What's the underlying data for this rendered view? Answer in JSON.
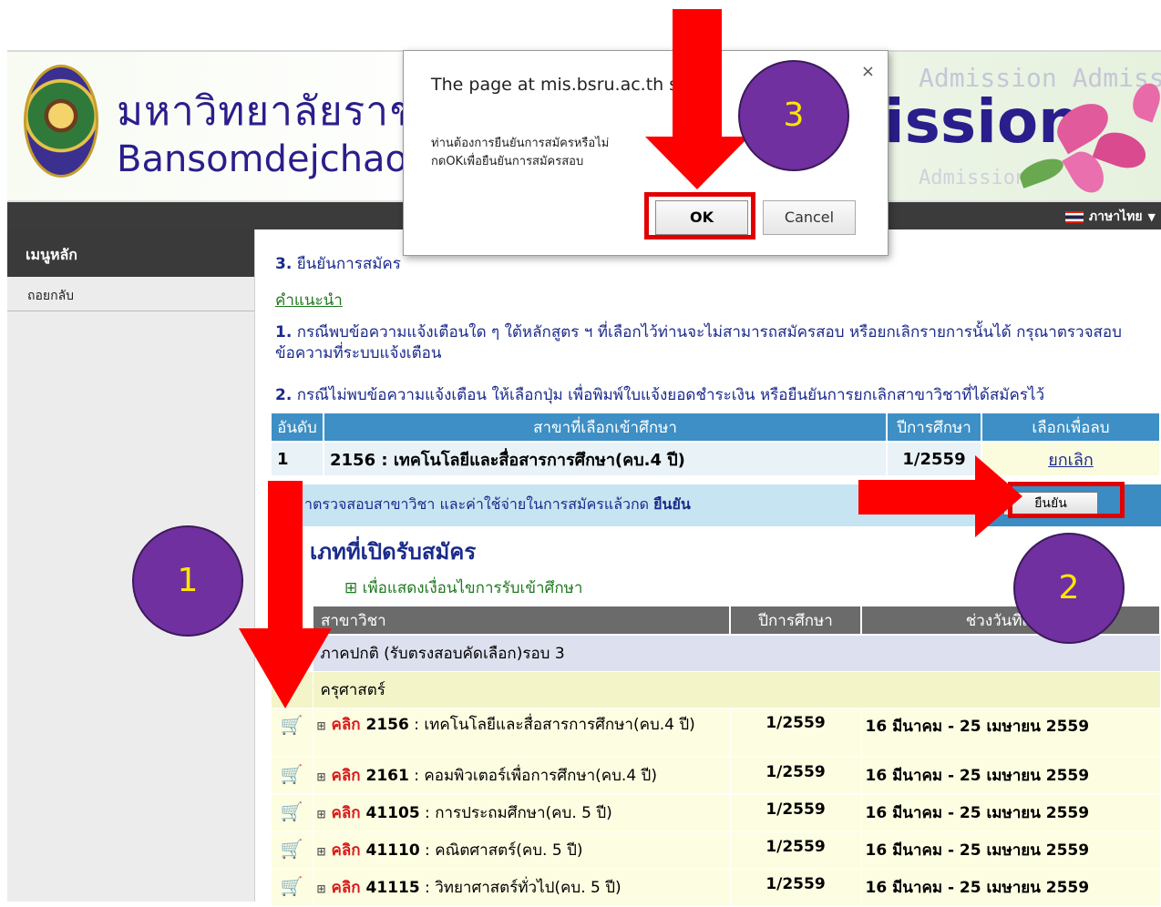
{
  "header": {
    "university_th": "มหาวิทยาลัยราชภัฏบ้าน",
    "university_en": "Bansomdejchaopraya",
    "admission_word": "ission",
    "admission_ghost_1": "Admission  Admiss",
    "admission_ghost_2": "Admission"
  },
  "navbar": {
    "language": "ภาษาไทย",
    "language_caret": "▼"
  },
  "sidebar": {
    "heading": "เมนูหลัก",
    "items": [
      {
        "label": "ถอยกลับ"
      }
    ]
  },
  "main": {
    "step_no": "3.",
    "step_title": " ยืนยันการสมัคร",
    "advice": "คำแนะนำ",
    "note1_no": "1.",
    "note1": " กรณีพบข้อความแจ้งเตือนใด ๆ ใต้หลักสูตร ฯ ที่เลือกไว้ท่านจะไม่สามารถสมัครสอบ หรือยกเลิกรายการนั้นได้ กรุณาตรวจสอบข้อความที่ระบบแจ้งเตือน",
    "note2_no": "2.",
    "note2": " กรณีไม่พบข้อความแจ้งเตือน ให้เลือกปุ่ม เพื่อพิมพ์ใบแจ้งยอดชำระเงิน หรือยืนยันการยกเลิกสาขาวิชาที่ได้สมัครไว้",
    "selected": {
      "headers": [
        "อันดับ",
        "สาขาที่เลือกเข้าศึกษา",
        "ปีการศึกษา",
        "เลือกเพื่อลบ"
      ],
      "rows": [
        {
          "rank": "1",
          "program": "2156 : เทคโนโลยีและสื่อสารการศึกษา(คบ.4 ปี)",
          "year": "1/2559",
          "action": "ยกเลิก"
        }
      ]
    },
    "confirm_text": "าตรวจสอบสาขาวิชา และค่าใช้จ่ายในการสมัครแล้วกด ",
    "confirm_link": "ยืนยัน",
    "confirm_button": "ยืนยัน",
    "open_title": "เภทที่เปิดรับสมัคร",
    "open_sub": "⊞  เพื่อแสดงเงื่อนไขการรับเข้าศึกษา",
    "programs": {
      "headers": [
        "สาขาวิชา",
        "ปีการศึกษา",
        "ช่วงวันที่เปิดร"
      ],
      "semester": "ภาคปกติ (รับตรงสอบคัดเลือก)รอบ 3",
      "faculty": "ครุศาสตร์",
      "click_label": "คลิก",
      "rows": [
        {
          "code": "2156",
          "name": " : เทคโนโลยีและสื่อสารการศึกษา(คบ.4 ปี)",
          "year": "1/2559",
          "period": "16 มีนาคม - 25 เมษายน 2559"
        },
        {
          "code": "2161",
          "name": " : คอมพิวเตอร์เพื่อการศึกษา(คบ.4 ปี)",
          "year": "1/2559",
          "period": "16 มีนาคม - 25 เมษายน 2559"
        },
        {
          "code": "41105",
          "name": " : การประถมศึกษา(คบ. 5 ปี)",
          "year": "1/2559",
          "period": "16 มีนาคม - 25 เมษายน 2559"
        },
        {
          "code": "41110",
          "name": " : คณิตศาสตร์(คบ. 5 ปี)",
          "year": "1/2559",
          "period": "16 มีนาคม - 25 เมษายน 2559"
        },
        {
          "code": "41115",
          "name": " : วิทยาศาสตร์ทั่วไป(คบ. 5 ปี)",
          "year": "1/2559",
          "period": "16 มีนาคม - 25 เมษายน 2559"
        }
      ]
    }
  },
  "dialog": {
    "title": "The page at mis.bsru.ac.th s",
    "message_line1": "ท่านต้องการยืนยันการสมัครหรือไม่",
    "message_line2": "กดOKเพื่อยืนยันการสมัครสอบ",
    "ok": "OK",
    "cancel": "Cancel",
    "close_glyph": "×"
  },
  "annotations": {
    "badge_1": "1",
    "badge_2": "2",
    "badge_3": "3",
    "arrow_color": "#ff0000",
    "badge_color": "#7030a0"
  }
}
